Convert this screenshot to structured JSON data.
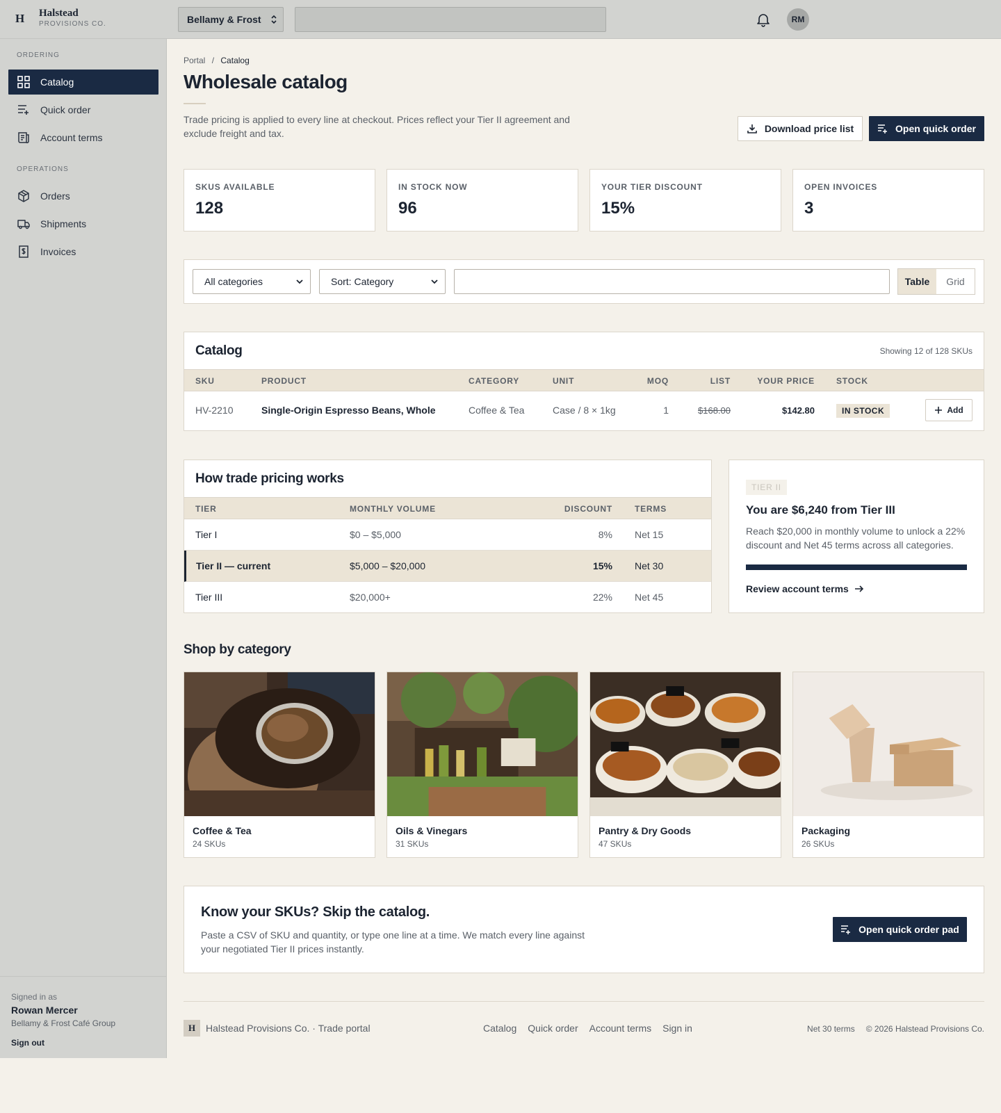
{
  "brand": {
    "mark": "H",
    "name": "Halstead",
    "sub": "PROVISIONS CO."
  },
  "topbar": {
    "account": "Bellamy & Frost",
    "avatar_initials": "RM"
  },
  "sidebar": {
    "section_ordering": "ORDERING",
    "section_operations": "OPERATIONS",
    "items": [
      {
        "label": "Catalog",
        "icon": "grid-icon",
        "active": true
      },
      {
        "label": "Quick order",
        "icon": "quick-order-icon"
      },
      {
        "label": "Account terms",
        "icon": "terms-icon"
      },
      {
        "label": "Orders",
        "icon": "box-icon"
      },
      {
        "label": "Shipments",
        "icon": "truck-icon"
      },
      {
        "label": "Invoices",
        "icon": "invoice-icon"
      }
    ],
    "signed_in_label": "Signed in as",
    "user_name": "Rowan Mercer",
    "user_org": "Bellamy & Frost Café Group",
    "sign_out": "Sign out"
  },
  "breadcrumb": {
    "root": "Portal",
    "sep": "/",
    "current": "Catalog"
  },
  "page": {
    "title": "Wholesale catalog",
    "intro": "Trade pricing is applied to every line at checkout. Prices reflect your Tier II agreement and exclude freight and tax.",
    "download_label": "Download price list",
    "quick_order_label": "Open quick order"
  },
  "stats": [
    {
      "label": "SKUS AVAILABLE",
      "value": "128"
    },
    {
      "label": "IN STOCK NOW",
      "value": "96"
    },
    {
      "label": "YOUR TIER DISCOUNT",
      "value": "15%"
    },
    {
      "label": "OPEN INVOICES",
      "value": "3"
    }
  ],
  "filters": {
    "category": "All categories",
    "sort": "Sort: Category",
    "view_table": "Table",
    "view_grid": "Grid"
  },
  "catalog": {
    "title": "Catalog",
    "showing": "Showing 12 of 128 SKUs",
    "columns": [
      "SKU",
      "PRODUCT",
      "CATEGORY",
      "UNIT",
      "MOQ",
      "LIST",
      "YOUR PRICE",
      "STOCK"
    ],
    "rows": [
      {
        "sku": "HV-2210",
        "product": "Single-Origin Espresso Beans, Whole",
        "category": "Coffee & Tea",
        "unit": "Case / 8 × 1kg",
        "moq": "1",
        "list": "$168.00",
        "price": "$142.80",
        "stock": "IN STOCK",
        "add": "Add"
      }
    ]
  },
  "pricing": {
    "title": "How trade pricing works",
    "columns": [
      "TIER",
      "MONTHLY VOLUME",
      "DISCOUNT",
      "TERMS"
    ],
    "rows": [
      {
        "tier": "Tier I",
        "volume": "$0 – $5,000",
        "discount": "8%",
        "terms": "Net 15"
      },
      {
        "tier": "Tier II — current",
        "volume": "$5,000 – $20,000",
        "discount": "15%",
        "terms": "Net 30"
      },
      {
        "tier": "Tier III",
        "volume": "$20,000+",
        "discount": "22%",
        "terms": "Net 45"
      }
    ]
  },
  "tier_card": {
    "badge": "TIER II",
    "title": "You are $6,240 from Tier III",
    "text": "Reach $20,000 in monthly volume to unlock a 22% discount and Net 45 terms across all categories.",
    "progress_fraction": 1.0,
    "link": "Review account terms"
  },
  "categories": {
    "title": "Shop by category",
    "items": [
      {
        "name": "Coffee & Tea",
        "count": "24 SKUs"
      },
      {
        "name": "Oils & Vinegars",
        "count": "31 SKUs"
      },
      {
        "name": "Pantry & Dry Goods",
        "count": "47 SKUs"
      },
      {
        "name": "Packaging",
        "count": "26 SKUs"
      }
    ]
  },
  "cta": {
    "title": "Know your SKUs? Skip the catalog.",
    "text": "Paste a CSV of SKU and quantity, or type one line at a time. We match every line against your negotiated Tier II prices instantly.",
    "button": "Open quick order pad"
  },
  "footer": {
    "mark": "H",
    "brand": "Halstead Provisions Co. · Trade portal",
    "links": [
      "Catalog",
      "Quick order",
      "Account terms",
      "Sign in"
    ],
    "terms": "Net 30 terms",
    "copyright": "© 2026 Halstead Provisions Co."
  },
  "colors": {
    "navy": "#1a2a43",
    "sand": "#ebe4d6",
    "background": "#f4f1ea",
    "chrome": "#d2d3d0"
  }
}
